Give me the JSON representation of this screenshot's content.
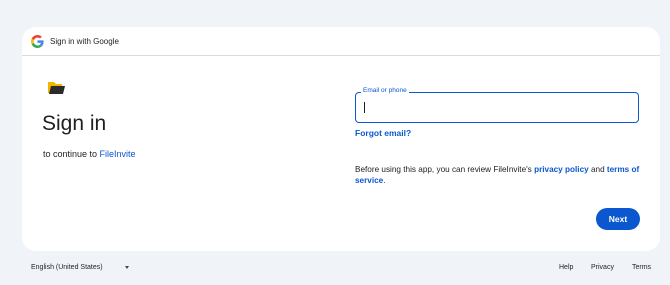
{
  "header": {
    "title": "Sign in with Google",
    "logo_icon": "google-g-icon"
  },
  "main": {
    "app_icon": "folder-icon",
    "title": "Sign in",
    "subtitle_prefix": "to continue to ",
    "app_name": "FileInvite"
  },
  "form": {
    "email_label": "Email or phone",
    "email_value": "",
    "forgot_email": "Forgot email?",
    "notice_prefix": "Before using this app, you can review FileInvite's ",
    "privacy_policy": "privacy policy",
    "notice_and": " and ",
    "terms_of_service": "terms of service",
    "notice_suffix": ".",
    "next_label": "Next"
  },
  "footer": {
    "language": "English (United States)",
    "help": "Help",
    "privacy": "Privacy",
    "terms": "Terms"
  },
  "colors": {
    "accent": "#0b57d0",
    "background": "#f0f4f9",
    "card": "#ffffff"
  }
}
